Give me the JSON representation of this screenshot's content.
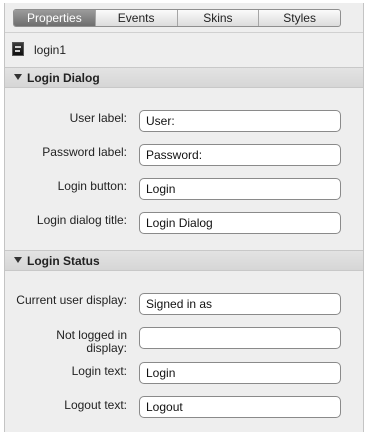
{
  "tabs": [
    "Properties",
    "Events",
    "Skins",
    "Styles"
  ],
  "object": {
    "name": "login1"
  },
  "sections": {
    "dialog": {
      "title": "Login Dialog",
      "fields": [
        {
          "label": "User label:",
          "value": "User:"
        },
        {
          "label": "Password label:",
          "value": "Password:"
        },
        {
          "label": "Login button:",
          "value": "Login"
        },
        {
          "label": "Login dialog title:",
          "value": "Login Dialog"
        }
      ]
    },
    "status": {
      "title": "Login Status",
      "fields": [
        {
          "label": "Current user display:",
          "value": "Signed in as"
        },
        {
          "label_line1": "Not logged in",
          "label_line2": "display:",
          "value": ""
        },
        {
          "label": "Login text:",
          "value": "Login"
        },
        {
          "label": "Logout text:",
          "value": "Logout"
        }
      ]
    }
  }
}
